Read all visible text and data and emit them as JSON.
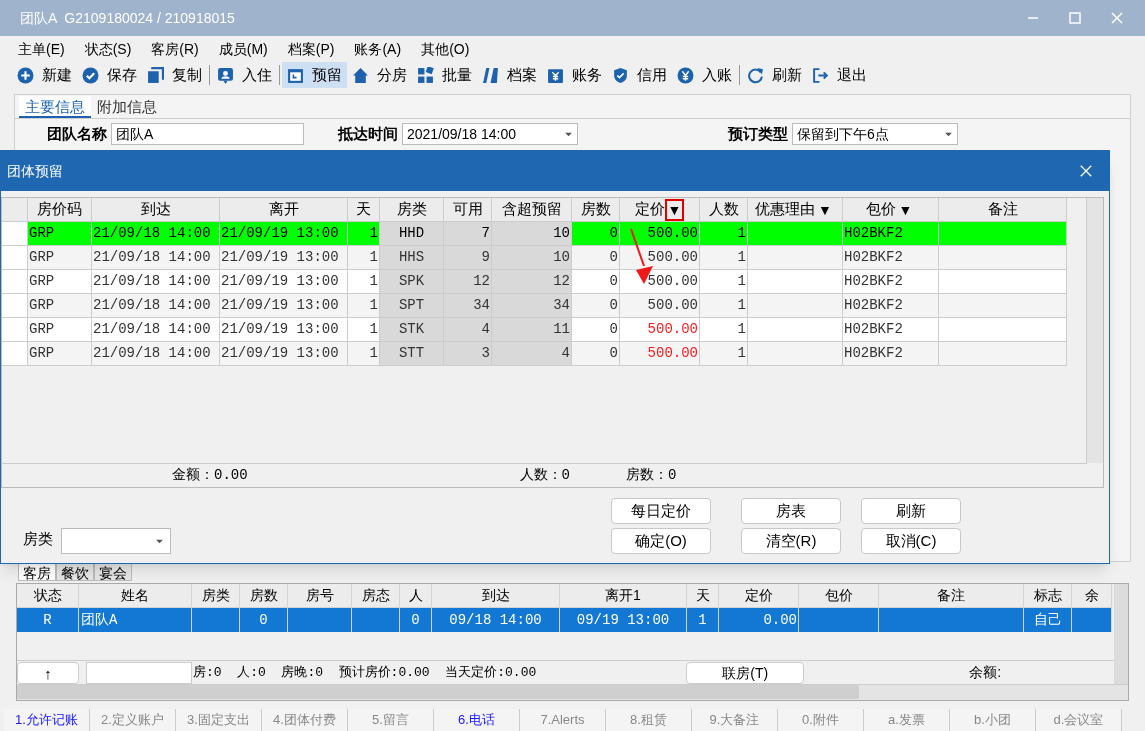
{
  "window": {
    "title": "团队A  G2109180024 / 210918015"
  },
  "menu": [
    "主单(E)",
    "状态(S)",
    "客房(R)",
    "成员(M)",
    "档案(P)",
    "账务(A)",
    "其他(O)"
  ],
  "toolbar": [
    {
      "kind": "add",
      "label": "新建",
      "selected": false
    },
    {
      "kind": "save",
      "label": "保存",
      "selected": false
    },
    {
      "kind": "copy",
      "label": "复制",
      "selected": false
    },
    {
      "kind": "separator"
    },
    {
      "kind": "checkin",
      "label": "入住",
      "selected": false
    },
    {
      "kind": "separator"
    },
    {
      "kind": "reserve",
      "label": "预留",
      "selected": true
    },
    {
      "kind": "assign",
      "label": "分房",
      "selected": false
    },
    {
      "kind": "batch",
      "label": "批量",
      "selected": false
    },
    {
      "kind": "profile",
      "label": "档案",
      "selected": false
    },
    {
      "kind": "account",
      "label": "账务",
      "selected": false
    },
    {
      "kind": "credit",
      "label": "信用",
      "selected": false
    },
    {
      "kind": "post",
      "label": "入账",
      "selected": false
    },
    {
      "kind": "separator"
    },
    {
      "kind": "refresh",
      "label": "刷新",
      "selected": false
    },
    {
      "kind": "exit",
      "label": "退出",
      "selected": false
    }
  ],
  "main_tabs": [
    {
      "label": "主要信息",
      "selected": true
    },
    {
      "label": "附加信息",
      "selected": false
    }
  ],
  "form": [
    {
      "label": "团队名称",
      "value": "团队A",
      "dropdown": false
    },
    {
      "label": "抵达时间",
      "value": "2021/09/18 14:00",
      "dropdown": true
    },
    {
      "label": "预订类型",
      "value": "保留到下午6点",
      "dropdown": true
    }
  ],
  "dialog": {
    "title": "团体预留",
    "columns": [
      {
        "label": "房价码"
      },
      {
        "label": "到达"
      },
      {
        "label": "离开"
      },
      {
        "label": "天"
      },
      {
        "label": "房类"
      },
      {
        "label": "可用"
      },
      {
        "label": "含超预留"
      },
      {
        "label": "房数"
      },
      {
        "label": "定价",
        "marker": {
          "text": "▼",
          "outlined": true
        }
      },
      {
        "label": "人数"
      },
      {
        "label": "优惠理由",
        "marker": {
          "text": "▼",
          "outlined": false
        }
      },
      {
        "label": "包价",
        "marker": {
          "text": "▼",
          "outlined": false
        }
      },
      {
        "label": "备注"
      }
    ],
    "rows": [
      {
        "selected": true,
        "price_flagged": false,
        "cells": [
          "GRP",
          "21/09/18 14:00",
          "21/09/19 13:00",
          "1",
          "HHD",
          "7",
          "10",
          "0",
          "500.00",
          "1",
          "",
          "H02BKF2",
          ""
        ]
      },
      {
        "selected": false,
        "price_flagged": false,
        "cells": [
          "GRP",
          "21/09/18 14:00",
          "21/09/19 13:00",
          "1",
          "HHS",
          "9",
          "10",
          "0",
          "500.00",
          "1",
          "",
          "H02BKF2",
          ""
        ]
      },
      {
        "selected": false,
        "price_flagged": false,
        "cells": [
          "GRP",
          "21/09/18 14:00",
          "21/09/19 13:00",
          "1",
          "SPK",
          "12",
          "12",
          "0",
          "500.00",
          "1",
          "",
          "H02BKF2",
          ""
        ]
      },
      {
        "selected": false,
        "price_flagged": false,
        "cells": [
          "GRP",
          "21/09/18 14:00",
          "21/09/19 13:00",
          "1",
          "SPT",
          "34",
          "34",
          "0",
          "500.00",
          "1",
          "",
          "H02BKF2",
          ""
        ]
      },
      {
        "selected": false,
        "price_flagged": true,
        "cells": [
          "GRP",
          "21/09/18 14:00",
          "21/09/19 13:00",
          "1",
          "STK",
          "4",
          "11",
          "0",
          "500.00",
          "1",
          "",
          "H02BKF2",
          ""
        ]
      },
      {
        "selected": false,
        "price_flagged": true,
        "cells": [
          "GRP",
          "21/09/18 14:00",
          "21/09/19 13:00",
          "1",
          "STT",
          "3",
          "4",
          "0",
          "500.00",
          "1",
          "",
          "H02BKF2",
          ""
        ]
      }
    ],
    "totals": [
      "金额：0.00",
      "人数：0",
      "房数：0"
    ],
    "room_type_label": "房类",
    "buttons": [
      [
        "每日定价",
        "确定(O)"
      ],
      [
        "房表",
        "清空(R)"
      ],
      [
        "刷新",
        "取消(C)"
      ]
    ]
  },
  "sub_tabs": [
    {
      "label": "客房",
      "selected": true
    },
    {
      "label": "餐饮",
      "selected": false
    },
    {
      "label": "宴会",
      "selected": false
    }
  ],
  "rooms": {
    "columns": [
      "状态",
      "姓名",
      "房类",
      "房数",
      "房号",
      "房态",
      "人",
      "到达",
      "离开1",
      "天",
      "定价",
      "包价",
      "备注",
      "标志",
      "余"
    ],
    "rows": [
      {
        "selected": true,
        "cells": [
          "R",
          "团队A",
          "",
          "0",
          "",
          "",
          "0",
          "09/18 14:00",
          "09/19 13:00",
          "1",
          "0.00",
          "",
          "",
          "自己",
          ""
        ]
      }
    ]
  },
  "footer": {
    "up_button": "↑",
    "stats": "房:0  人:0  房晚:0  预计房价:0.00  当天定价:0.00",
    "link_button": "联房(T)",
    "balance": "余额:"
  },
  "bottom_tabs": [
    {
      "label": "1.允许记账",
      "active": true
    },
    {
      "label": "2.定义账户",
      "active": false
    },
    {
      "label": "3.固定支出",
      "active": false
    },
    {
      "label": "4.团体付费",
      "active": false
    },
    {
      "label": "5.留言",
      "active": false
    },
    {
      "label": "6.电话",
      "active": true
    },
    {
      "label": "7.Alerts",
      "active": false
    },
    {
      "label": "8.租赁",
      "active": false
    },
    {
      "label": "9.大备注",
      "active": false
    },
    {
      "label": "0.附件",
      "active": false
    },
    {
      "label": "a.发票",
      "active": false
    },
    {
      "label": "b.小团",
      "active": false
    },
    {
      "label": "d.会议室",
      "active": false
    }
  ]
}
